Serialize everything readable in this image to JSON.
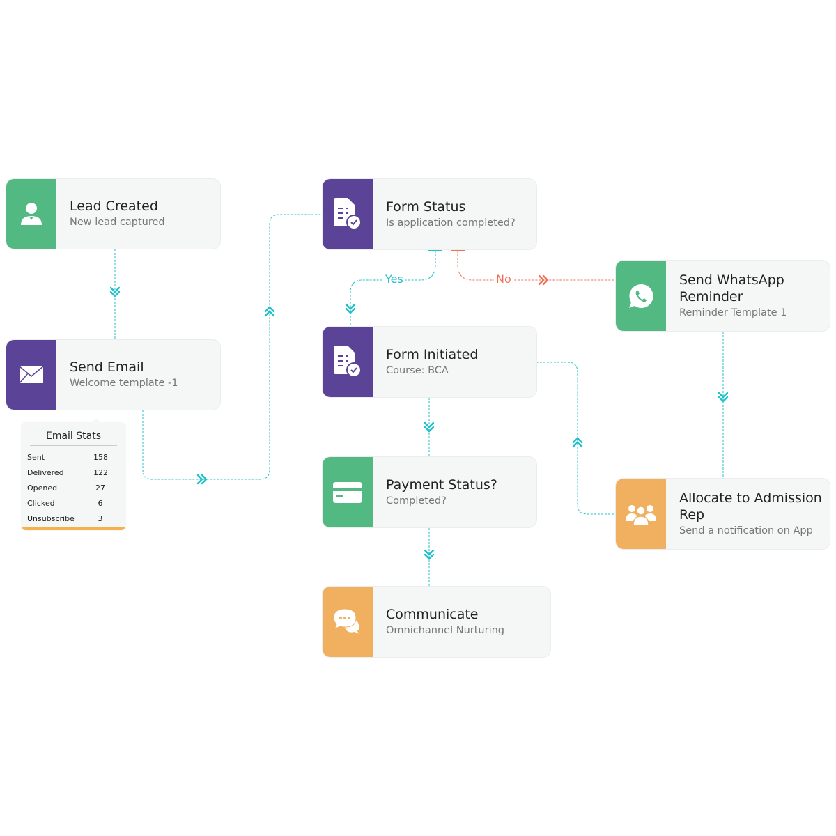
{
  "colors": {
    "green": "#52b982",
    "purple": "#5b4397",
    "orange": "#f0b060",
    "connector": "#22c0c8",
    "no_branch": "#f0705a"
  },
  "nodes": {
    "lead_created": {
      "title": "Lead Created",
      "subtitle": "New lead captured",
      "icon": "user-icon"
    },
    "send_email": {
      "title": "Send Email",
      "subtitle": "Welcome template -1",
      "icon": "envelope-icon"
    },
    "form_status": {
      "title": "Form Status",
      "subtitle": "Is application completed?",
      "icon": "form-check-icon"
    },
    "form_initiated": {
      "title": "Form Initiated",
      "subtitle": "Course: BCA",
      "icon": "form-check-icon"
    },
    "payment_status": {
      "title": "Payment Status?",
      "subtitle": "Completed?",
      "icon": "credit-card-icon"
    },
    "communicate": {
      "title": "Communicate",
      "subtitle": "Omnichannel Nurturing",
      "icon": "chat-bubbles-icon"
    },
    "whatsapp": {
      "title": "Send WhatsApp Reminder",
      "subtitle": "Reminder Template 1",
      "icon": "whatsapp-icon"
    },
    "allocate": {
      "title": "Allocate to Admission Rep",
      "subtitle": "Send a notification on App",
      "icon": "users-group-icon"
    }
  },
  "email_stats": {
    "title": "Email Stats",
    "rows": [
      {
        "label": "Sent",
        "value": "158"
      },
      {
        "label": "Delivered",
        "value": "122"
      },
      {
        "label": "Opened",
        "value": "27"
      },
      {
        "label": "Clicked",
        "value": "6"
      },
      {
        "label": "Unsubscribe",
        "value": "3"
      }
    ]
  },
  "branches": {
    "yes": "Yes",
    "no": "No"
  }
}
